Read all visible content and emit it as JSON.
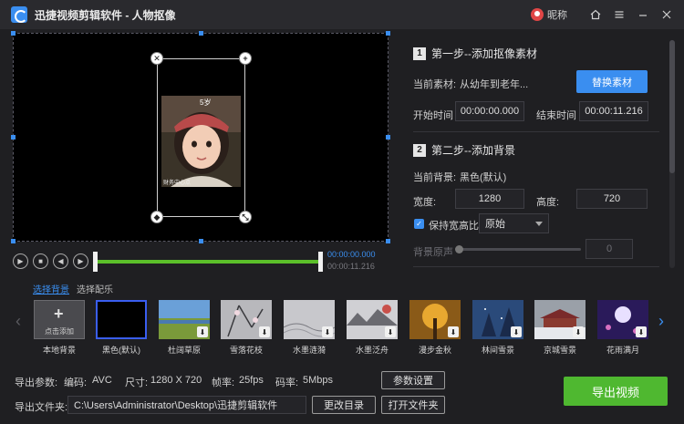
{
  "window": {
    "title": "迅捷视频剪辑软件 - 人物抠像",
    "user_label": "昵称",
    "controls": [
      "home-icon",
      "menu-icon",
      "minimize-icon",
      "close-icon"
    ]
  },
  "preview": {
    "photo_badge": "5岁",
    "photo_caption": "财务中心点"
  },
  "playback": {
    "current_time": "00:00:00.000",
    "total_time": "00:00:11.216",
    "progress": 1.0
  },
  "step1": {
    "num": "1",
    "title": "第一步--添加抠像素材",
    "current_label": "当前素材:",
    "current_value": "从幼年到老年...",
    "replace_button": "替换素材",
    "start_label": "开始时间",
    "start_value": "00:00:00.000",
    "end_label": "结束时间",
    "end_value": "00:00:11.216"
  },
  "step2": {
    "num": "2",
    "title": "第二步--添加背景",
    "bg_label": "当前背景:",
    "bg_value": "黑色(默认)",
    "width_label": "宽度:",
    "width_value": "1280",
    "height_label": "高度:",
    "height_value": "720",
    "keep_ratio_label": "保持宽高比",
    "keep_ratio_checked": true,
    "ratio_option": "原始",
    "audio_label": "背景原声",
    "audio_value": "0"
  },
  "tabs": [
    "选择背景",
    "选择配乐"
  ],
  "carousel": {
    "items": [
      {
        "label": "本地背景",
        "add_text": "点击添加",
        "type": "add"
      },
      {
        "label": "黑色(默认)",
        "type": "selected"
      },
      {
        "label": "杜阔草原",
        "type": "download"
      },
      {
        "label": "雪落花枝",
        "type": "download"
      },
      {
        "label": "水墨涟漪",
        "type": "download"
      },
      {
        "label": "水墨泛舟",
        "type": "download"
      },
      {
        "label": "漫步金秋",
        "type": "download"
      },
      {
        "label": "林间雪景",
        "type": "download"
      },
      {
        "label": "京城雪景",
        "type": "download"
      },
      {
        "label": "花雨满月",
        "type": "download"
      }
    ]
  },
  "bottom": {
    "params_label": "导出参数:",
    "codec_label": "编码:",
    "codec_value": "AVC",
    "size_label": "尺寸:",
    "size_value": "1280 X 720",
    "fps_label": "帧率:",
    "fps_value": "25fps",
    "bitrate_label": "码率:",
    "bitrate_value": "5Mbps",
    "param_settings_button": "参数设置",
    "folder_label": "导出文件夹:",
    "folder_value": "C:\\Users\\Administrator\\Desktop\\迅捷剪辑软件",
    "change_dir_button": "更改目录",
    "open_folder_button": "打开文件夹",
    "export_button": "导出视频"
  },
  "colors": {
    "accent_blue": "#3a8ef0",
    "export_green": "#4fb830",
    "track_green": "#5bbf2a"
  }
}
